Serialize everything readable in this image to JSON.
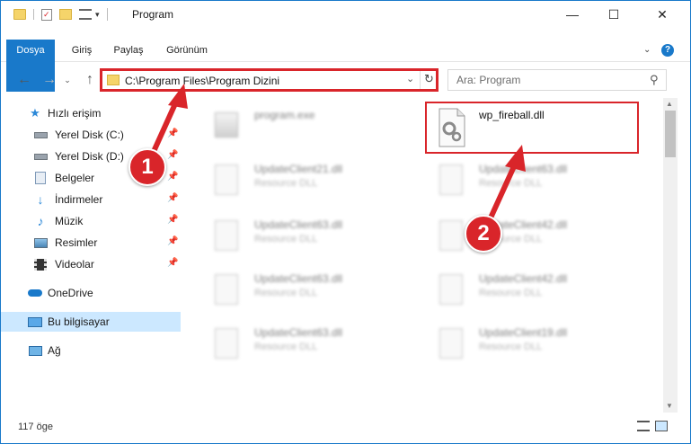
{
  "window": {
    "title": "Program",
    "controls": {
      "minimize": "—",
      "maximize": "☐",
      "close": "✕"
    }
  },
  "ribbon": {
    "tabs": [
      {
        "label": "Dosya",
        "active": true
      },
      {
        "label": "Giriş"
      },
      {
        "label": "Paylaş"
      },
      {
        "label": "Görünüm"
      }
    ],
    "help_icon": "help-icon"
  },
  "address": {
    "path": "C:\\Program Files\\Program Dizini",
    "search_placeholder": "Ara: Program"
  },
  "nav": {
    "quick_access": "Hızlı erişim",
    "items": [
      {
        "label": "Yerel Disk (C:)",
        "icon": "drive-icon"
      },
      {
        "label": "Yerel Disk (D:)",
        "icon": "drive-icon"
      },
      {
        "label": "Belgeler",
        "icon": "documents-icon"
      },
      {
        "label": "İndirmeler",
        "icon": "downloads-icon"
      },
      {
        "label": "Müzik",
        "icon": "music-icon"
      },
      {
        "label": "Resimler",
        "icon": "pictures-icon"
      },
      {
        "label": "Videolar",
        "icon": "videos-icon"
      }
    ],
    "onedrive": "OneDrive",
    "this_pc": "Bu bilgisayar",
    "network": "Ağ"
  },
  "files": [
    {
      "name": "program.exe",
      "type": "",
      "blurred": true
    },
    {
      "name": "wp_fireball.dll",
      "type": "",
      "blurred": false
    },
    {
      "name": "UpdateClient21.dll",
      "type": "Resource DLL",
      "blurred": true
    },
    {
      "name": "UpdateClient63.dll",
      "type": "Resource DLL",
      "blurred": true
    },
    {
      "name": "UpdateClient63.dll",
      "type": "Resource DLL",
      "blurred": true
    },
    {
      "name": "UpdateClient42.dll",
      "type": "Resource DLL",
      "blurred": true
    },
    {
      "name": "UpdateClient63.dll",
      "type": "Resource DLL",
      "blurred": true
    },
    {
      "name": "UpdateClient42.dll",
      "type": "Resource DLL",
      "blurred": true
    },
    {
      "name": "UpdateClient63.dll",
      "type": "Resource DLL",
      "blurred": true
    },
    {
      "name": "UpdateClient19.dll",
      "type": "Resource DLL",
      "blurred": true
    }
  ],
  "status": {
    "count": "117 öge"
  },
  "annotations": {
    "step1": "1",
    "step2": "2",
    "color": "#d9252a"
  },
  "colors": {
    "accent": "#1979ca",
    "selected": "#cce8ff"
  }
}
